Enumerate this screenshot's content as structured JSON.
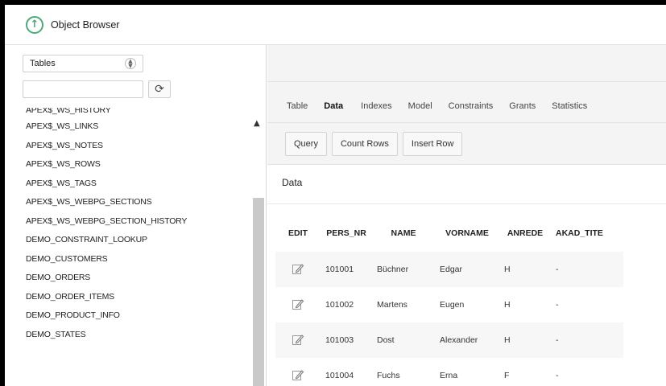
{
  "app": {
    "title": "Object Browser",
    "icon": "up-arrow-circle-icon"
  },
  "object_browser": {
    "object_type": "Tables",
    "search_value": "",
    "tables": [
      "APEX$_WS_HISTORY",
      "APEX$_WS_LINKS",
      "APEX$_WS_NOTES",
      "APEX$_WS_ROWS",
      "APEX$_WS_TAGS",
      "APEX$_WS_WEBPG_SECTIONS",
      "APEX$_WS_WEBPG_SECTION_HISTORY",
      "DEMO_CONSTRAINT_LOOKUP",
      "DEMO_CUSTOMERS",
      "DEMO_ORDERS",
      "DEMO_ORDER_ITEMS",
      "DEMO_PRODUCT_INFO",
      "DEMO_STATES"
    ]
  },
  "tabs": [
    "Table",
    "Data",
    "Indexes",
    "Model",
    "Constraints",
    "Grants",
    "Statistics"
  ],
  "active_tab": "Data",
  "toolbar": {
    "query": "Query",
    "count_rows": "Count Rows",
    "insert_row": "Insert Row"
  },
  "region": {
    "title": "Data"
  },
  "grid": {
    "columns": [
      "EDIT",
      "PERS_NR",
      "NAME",
      "VORNAME",
      "ANREDE",
      "AKAD_TITE"
    ],
    "rows": [
      {
        "pers_nr": "101001",
        "name": "Büchner",
        "vorname": "Edgar",
        "anrede": "H",
        "akad": "-"
      },
      {
        "pers_nr": "101002",
        "name": "Martens",
        "vorname": "Eugen",
        "anrede": "H",
        "akad": "-"
      },
      {
        "pers_nr": "101003",
        "name": "Dost",
        "vorname": "Alexander",
        "anrede": "H",
        "akad": "-"
      },
      {
        "pers_nr": "101004",
        "name": "Fuchs",
        "vorname": "Erna",
        "anrede": "F",
        "akad": "-"
      }
    ]
  },
  "colors": {
    "accent": "#4ea87a",
    "panel_bg": "#f4f4f4",
    "scrollbar": "#c9c9c9"
  }
}
